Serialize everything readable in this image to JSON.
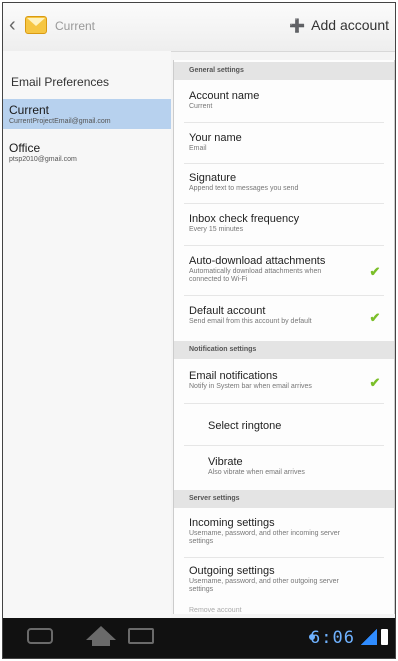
{
  "action_bar": {
    "title": "Current",
    "add_account_label": "Add account",
    "back_icon": "chevron-left-icon",
    "app_icon": "email-envelope-icon",
    "add_icon": "add-account-icon"
  },
  "left_pane": {
    "preferences_label": "Email Preferences",
    "accounts": [
      {
        "name": "Current",
        "email": "CurrentProjectEmail@gmail.com",
        "selected": true
      },
      {
        "name": "Office",
        "email": "ptsp2010@gmail.com",
        "selected": false
      }
    ]
  },
  "settings": {
    "general_header": "General settings",
    "account_name": {
      "title": "Account name",
      "summary": "Current"
    },
    "your_name": {
      "title": "Your name",
      "summary": "Email"
    },
    "signature": {
      "title": "Signature",
      "summary": "Append text to messages you send"
    },
    "inbox_check": {
      "title": "Inbox check frequency",
      "summary": "Every 15 minutes"
    },
    "auto_download": {
      "title": "Auto-download attachments",
      "summary": "Automatically download attachments when connected to Wi-Fi",
      "checked": true
    },
    "default_account": {
      "title": "Default account",
      "summary": "Send email from this account by default",
      "checked": true
    },
    "notification_header": "Notification settings",
    "email_notifications": {
      "title": "Email notifications",
      "summary": "Notify in System bar when email arrives",
      "checked": true
    },
    "select_ringtone": {
      "title": "Select ringtone"
    },
    "vibrate": {
      "title": "Vibrate",
      "summary": "Also vibrate when email arrives"
    },
    "server_header": "Server settings",
    "incoming": {
      "title": "Incoming settings",
      "summary": "Username, password, and other incoming server settings"
    },
    "outgoing": {
      "title": "Outgoing settings",
      "summary": "Username, password, and other outgoing server settings"
    },
    "remove_account": "Remove account"
  },
  "system_bar": {
    "time": "6:06",
    "back_icon": "back-nav-icon",
    "home_icon": "home-nav-icon",
    "recent_icon": "recent-apps-icon",
    "signal_icon": "wifi-signal-icon",
    "battery_icon": "battery-icon"
  },
  "colors": {
    "selected_account": "#b7d1ee",
    "checkmark": "#7bbf2a",
    "clock": "#6fb2ff"
  }
}
